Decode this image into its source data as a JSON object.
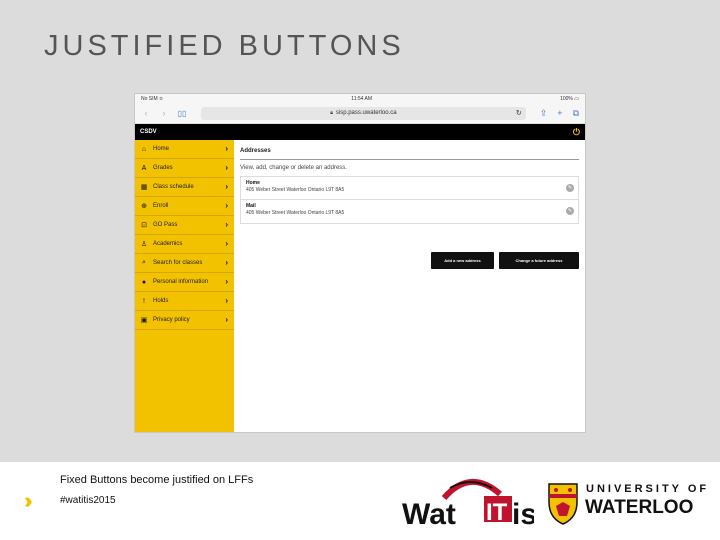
{
  "slide": {
    "title": "JUSTIFIED BUTTONS",
    "caption": "Fixed Buttons become justified on LFFs",
    "hashtag": "#watitis2015",
    "brand_colors": {
      "gold": "#f2c200",
      "red": "#c0142e",
      "black": "#111111"
    }
  },
  "device": {
    "status": {
      "carrier": "No SIM ≎",
      "time": "11:54 AM",
      "battery": "100% ▭"
    },
    "browser": {
      "url": "sisp.pass.uwaterloo.ca",
      "icons": [
        "back-icon",
        "forward-icon",
        "bookmarks-icon",
        "lock-icon",
        "reload-icon",
        "share-icon",
        "new-tab-icon",
        "tabs-icon"
      ]
    },
    "app": {
      "name": "CSDV",
      "power_icon": "power-icon",
      "sidebar": [
        {
          "label": "Home",
          "icon": "home-icon",
          "glyph": "⌂"
        },
        {
          "label": "Grades",
          "icon": "grades-icon",
          "glyph": "A"
        },
        {
          "label": "Class schedule",
          "icon": "calendar-icon",
          "glyph": "▦"
        },
        {
          "label": "Enroll",
          "icon": "cart-icon",
          "glyph": "⊕"
        },
        {
          "label": "GO Pass",
          "icon": "bus-icon",
          "glyph": "⊡"
        },
        {
          "label": "Academics",
          "icon": "academics-icon",
          "glyph": "♙"
        },
        {
          "label": "Search for classes",
          "icon": "search-icon",
          "glyph": "⌕"
        },
        {
          "label": "Personal information",
          "icon": "person-icon",
          "glyph": "●"
        },
        {
          "label": "Holds",
          "icon": "holds-icon",
          "glyph": "!"
        },
        {
          "label": "Privacy policy",
          "icon": "lock-icon",
          "glyph": "▣"
        }
      ],
      "main": {
        "title": "Addresses",
        "description": "View, add, change or delete an address.",
        "addresses": [
          {
            "name": "Home",
            "line": "405 Weber Street Waterloo Ontario L9T 8A5"
          },
          {
            "name": "Mail",
            "line": "405 Weber Street Waterloo Ontario L9T 8A5"
          }
        ],
        "add_button": "Add a new address",
        "change_button": "Change a future address"
      }
    }
  },
  "logos": {
    "watitis": "WatITis",
    "uw_line1": "UNIVERSITY OF",
    "uw_line2": "WATERLOO"
  }
}
